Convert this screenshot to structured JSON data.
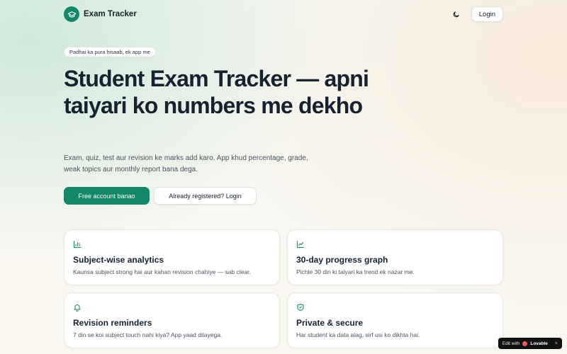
{
  "nav": {
    "brand": "Exam Tracker",
    "brand_icon": "graduation-cap-icon",
    "theme_icon": "moon-icon",
    "login_label": "Login"
  },
  "hero": {
    "tagline": "Padhai ka pura hisaab, ek app me",
    "title": "Student Exam Tracker — apni taiyari ko numbers me dekho",
    "subtitle": "Exam, quiz, test aur revision ke marks add karo. App khud percentage, grade, weak topics aur monthly report bana dega.",
    "primary_cta": "Free account banao",
    "secondary_cta": "Already registered? Login"
  },
  "features": [
    {
      "icon": "bar-chart-icon",
      "title": "Subject-wise analytics",
      "desc": "Kaunsa subject strong hai aur kahan revision chahiye — sab clear."
    },
    {
      "icon": "trend-line-icon",
      "title": "30-day progress graph",
      "desc": "Pichle 30 din ki taiyari ka trend ek nazar me."
    },
    {
      "icon": "bell-icon",
      "title": "Revision reminders",
      "desc": "7 din se koi subject touch nahi kiya? App yaad dilayega."
    },
    {
      "icon": "shield-check-icon",
      "title": "Private & secure",
      "desc": "Har student ka data alag, sirf usi ko dikhta hai."
    }
  ],
  "badge": {
    "prefix": "Edit with",
    "brand": "Lovable",
    "close": "×"
  },
  "colors": {
    "accent": "#13876a",
    "text": "#162231",
    "muted": "#4a5460"
  }
}
